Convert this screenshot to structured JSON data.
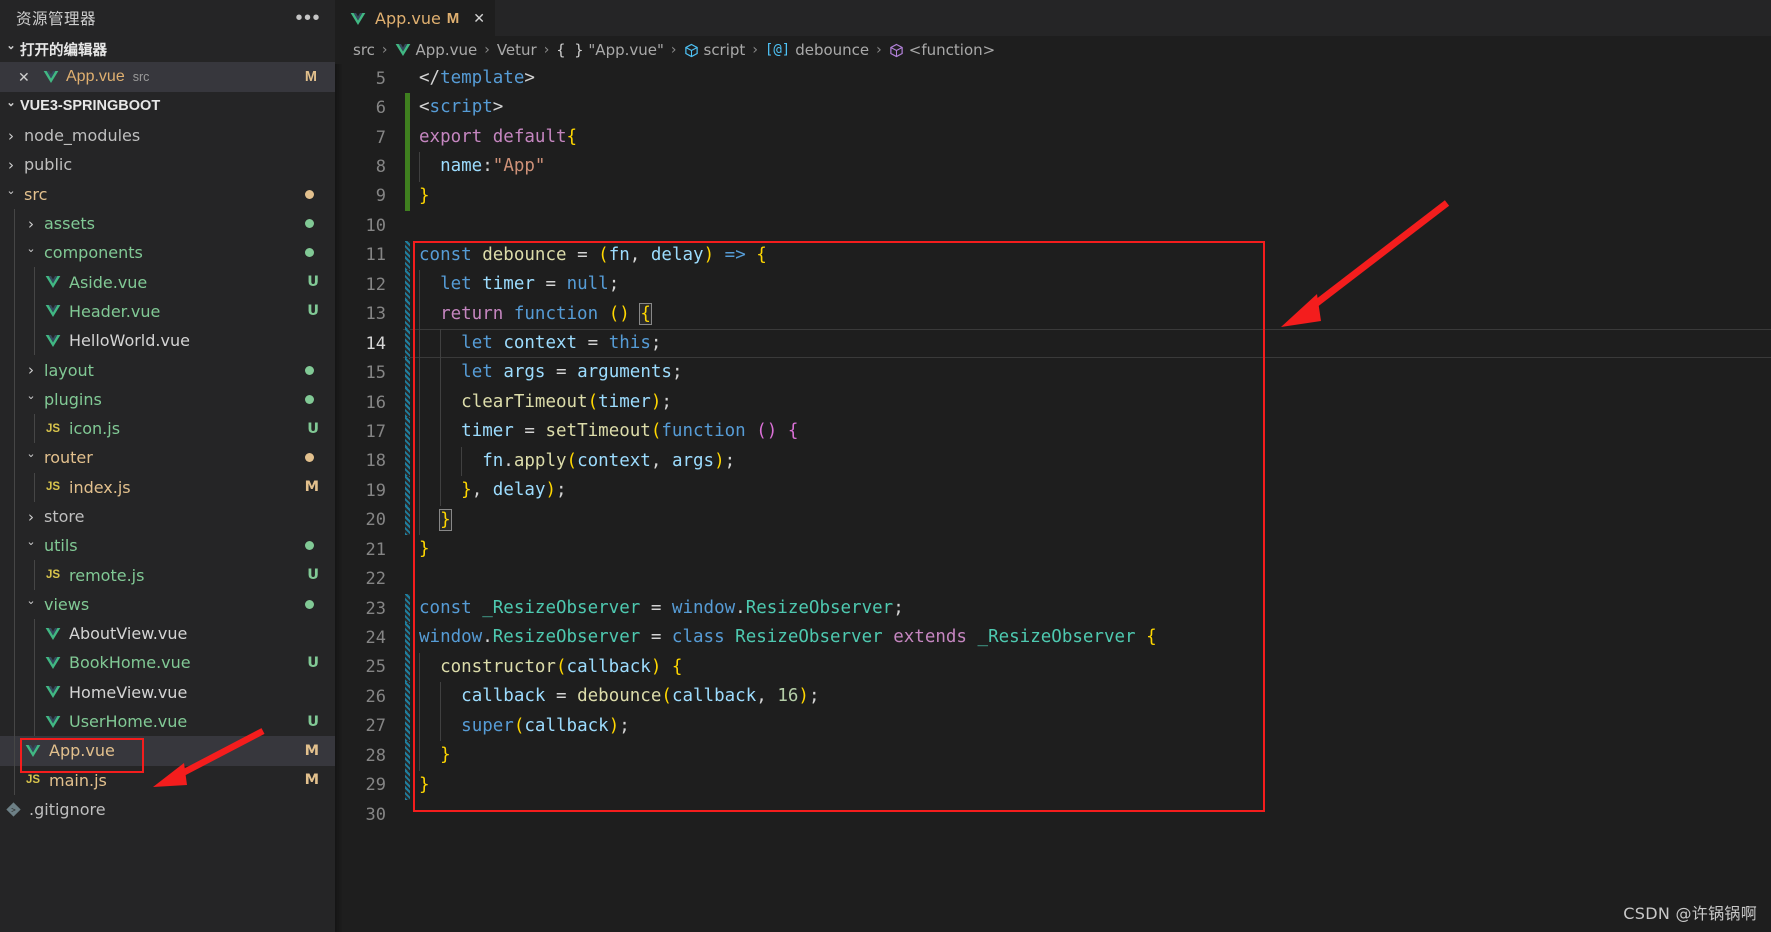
{
  "sidebar": {
    "title": "资源管理器",
    "more_icon": "ellipsis-icon",
    "open_editors": {
      "label": "打开的编辑器",
      "items": [
        {
          "name": "App.vue",
          "folder": "src",
          "badge": "M",
          "icon": "vue-icon",
          "close_icon": "close-icon"
        }
      ]
    },
    "workspace": {
      "label": "VUE3-SPRINGBOOT",
      "items": [
        {
          "label": "node_modules",
          "type": "folder",
          "state": "closed",
          "indent": 1,
          "color": "#bfbfbf",
          "badge": "",
          "dot": ""
        },
        {
          "label": "public",
          "type": "folder",
          "state": "closed",
          "indent": 1,
          "color": "#bfbfbf",
          "badge": "",
          "dot": ""
        },
        {
          "label": "src",
          "type": "folder",
          "state": "open",
          "indent": 1,
          "color": "#e2c08d",
          "badge": "",
          "dot": "#e2c08d"
        },
        {
          "label": "assets",
          "type": "folder",
          "state": "closed",
          "indent": 2,
          "color": "#81c995",
          "badge": "",
          "dot": "#81c995"
        },
        {
          "label": "components",
          "type": "folder",
          "state": "open",
          "indent": 2,
          "color": "#81c995",
          "badge": "",
          "dot": "#81c995"
        },
        {
          "label": "Aside.vue",
          "type": "vue",
          "state": "",
          "indent": 3,
          "color": "#81c995",
          "badge": "U",
          "dot": ""
        },
        {
          "label": "Header.vue",
          "type": "vue",
          "state": "",
          "indent": 3,
          "color": "#81c995",
          "badge": "U",
          "dot": ""
        },
        {
          "label": "HelloWorld.vue",
          "type": "vue",
          "state": "",
          "indent": 3,
          "color": "#d4d4d4",
          "badge": "",
          "dot": ""
        },
        {
          "label": "layout",
          "type": "folder",
          "state": "closed",
          "indent": 2,
          "color": "#81c995",
          "badge": "",
          "dot": "#81c995"
        },
        {
          "label": "plugins",
          "type": "folder",
          "state": "open",
          "indent": 2,
          "color": "#81c995",
          "badge": "",
          "dot": "#81c995"
        },
        {
          "label": "icon.js",
          "type": "js",
          "state": "",
          "indent": 3,
          "color": "#81c995",
          "badge": "U",
          "dot": ""
        },
        {
          "label": "router",
          "type": "folder",
          "state": "open",
          "indent": 2,
          "color": "#e2c08d",
          "badge": "",
          "dot": "#e2c08d"
        },
        {
          "label": "index.js",
          "type": "js",
          "state": "",
          "indent": 3,
          "color": "#e2c08d",
          "badge": "M",
          "dot": ""
        },
        {
          "label": "store",
          "type": "folder",
          "state": "closed",
          "indent": 2,
          "color": "#bfbfbf",
          "badge": "",
          "dot": ""
        },
        {
          "label": "utils",
          "type": "folder",
          "state": "open",
          "indent": 2,
          "color": "#81c995",
          "badge": "",
          "dot": "#81c995"
        },
        {
          "label": "remote.js",
          "type": "js",
          "state": "",
          "indent": 3,
          "color": "#81c995",
          "badge": "U",
          "dot": ""
        },
        {
          "label": "views",
          "type": "folder",
          "state": "open",
          "indent": 2,
          "color": "#81c995",
          "badge": "",
          "dot": "#81c995"
        },
        {
          "label": "AboutView.vue",
          "type": "vue",
          "state": "",
          "indent": 3,
          "color": "#d4d4d4",
          "badge": "",
          "dot": ""
        },
        {
          "label": "BookHome.vue",
          "type": "vue",
          "state": "",
          "indent": 3,
          "color": "#81c995",
          "badge": "U",
          "dot": ""
        },
        {
          "label": "HomeView.vue",
          "type": "vue",
          "state": "",
          "indent": 3,
          "color": "#d4d4d4",
          "badge": "",
          "dot": ""
        },
        {
          "label": "UserHome.vue",
          "type": "vue",
          "state": "",
          "indent": 3,
          "color": "#81c995",
          "badge": "U",
          "dot": ""
        },
        {
          "label": "App.vue",
          "type": "vue",
          "state": "",
          "indent": 2,
          "color": "#e2c08d",
          "badge": "M",
          "dot": "",
          "selected": true
        },
        {
          "label": "main.js",
          "type": "js",
          "state": "",
          "indent": 2,
          "color": "#e2c08d",
          "badge": "M",
          "dot": ""
        },
        {
          "label": ".gitignore",
          "type": "git",
          "state": "",
          "indent": 1,
          "color": "#bfbfbf",
          "badge": "",
          "dot": ""
        }
      ]
    }
  },
  "editor": {
    "tab": {
      "label": "App.vue",
      "modified_badge": "M",
      "icon": "vue-icon",
      "close_icon": "close-icon"
    },
    "breadcrumb": [
      {
        "label": "src",
        "icon": ""
      },
      {
        "label": "App.vue",
        "icon": "vue-icon"
      },
      {
        "label": "Vetur",
        "icon": ""
      },
      {
        "label": "\"App.vue\"",
        "icon": "braces-icon"
      },
      {
        "label": "script",
        "icon": "cube-blue-icon"
      },
      {
        "label": "debounce",
        "icon": "variable-icon"
      },
      {
        "label": "<function>",
        "icon": "cube-purple-icon"
      }
    ],
    "first_visible_line": 5,
    "active_line": 14,
    "lines": [
      {
        "n": 5,
        "gutter": "",
        "text": "</template>"
      },
      {
        "n": 6,
        "gutter": "green",
        "text": "<script>"
      },
      {
        "n": 7,
        "gutter": "green",
        "text": "export default{"
      },
      {
        "n": 8,
        "gutter": "green",
        "text": "  name:\"App\""
      },
      {
        "n": 9,
        "gutter": "green",
        "text": "}"
      },
      {
        "n": 10,
        "gutter": "",
        "text": ""
      },
      {
        "n": 11,
        "gutter": "stripe",
        "text": "const debounce = (fn, delay) => {"
      },
      {
        "n": 12,
        "gutter": "stripe",
        "text": "  let timer = null;"
      },
      {
        "n": 13,
        "gutter": "stripe",
        "text": "  return function () {"
      },
      {
        "n": 14,
        "gutter": "stripe",
        "text": "    let context = this;"
      },
      {
        "n": 15,
        "gutter": "stripe",
        "text": "    let args = arguments;"
      },
      {
        "n": 16,
        "gutter": "stripe",
        "text": "    clearTimeout(timer);"
      },
      {
        "n": 17,
        "gutter": "stripe",
        "text": "    timer = setTimeout(function () {"
      },
      {
        "n": 18,
        "gutter": "stripe",
        "text": "      fn.apply(context, args);"
      },
      {
        "n": 19,
        "gutter": "stripe",
        "text": "    }, delay);"
      },
      {
        "n": 20,
        "gutter": "stripe",
        "text": "  }"
      },
      {
        "n": 21,
        "gutter": "",
        "text": "}"
      },
      {
        "n": 22,
        "gutter": "",
        "text": ""
      },
      {
        "n": 23,
        "gutter": "stripe",
        "text": "const _ResizeObserver = window.ResizeObserver;"
      },
      {
        "n": 24,
        "gutter": "stripe",
        "text": "window.ResizeObserver = class ResizeObserver extends _ResizeObserver {"
      },
      {
        "n": 25,
        "gutter": "stripe",
        "text": "  constructor(callback) {"
      },
      {
        "n": 26,
        "gutter": "stripe",
        "text": "    callback = debounce(callback, 16);"
      },
      {
        "n": 27,
        "gutter": "stripe",
        "text": "    super(callback);"
      },
      {
        "n": 28,
        "gutter": "stripe",
        "text": "  }"
      },
      {
        "n": 29,
        "gutter": "stripe",
        "text": "}"
      },
      {
        "n": 30,
        "gutter": "",
        "text": ""
      }
    ]
  },
  "annotations": {
    "highlight_color": "#f41d1d",
    "watermark": "CSDN @许锅锅啊"
  }
}
